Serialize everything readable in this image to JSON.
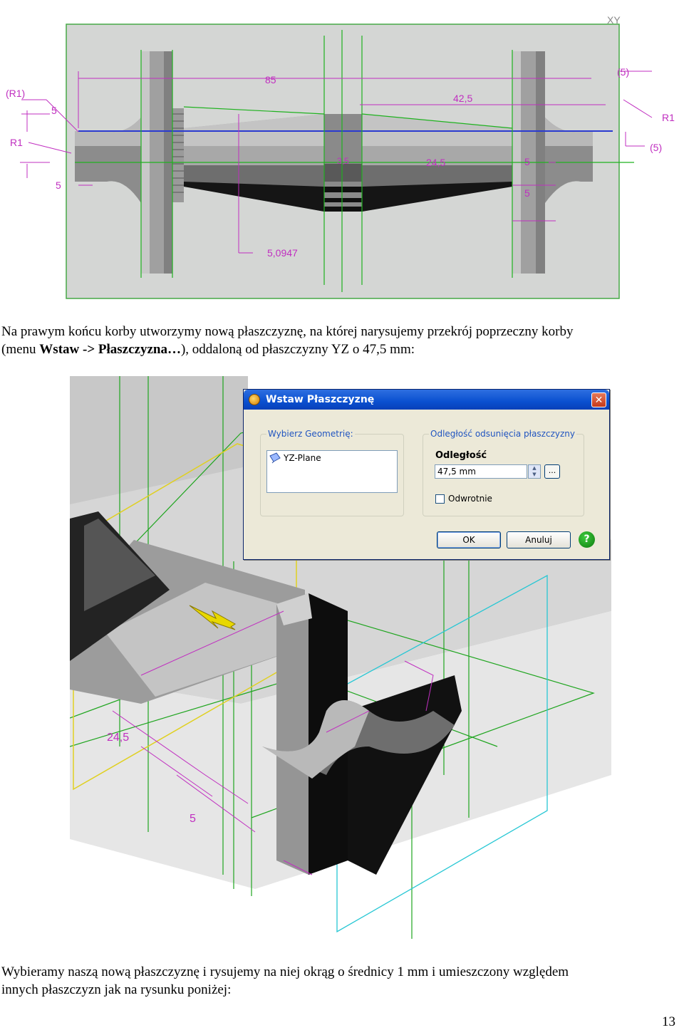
{
  "figure1": {
    "corner_label": "XY",
    "dimensions": {
      "r1_left_paren": "(R1)",
      "five_a": "5",
      "r1_left": "R1",
      "five_b": "5",
      "eighty_five": "85",
      "forty_two": "42,5",
      "five_paren_right": "(5)",
      "r1_right": "R1",
      "five_paren_right_b": "(5)",
      "twenty_four": "24,5",
      "five_c": "5",
      "five_d": "5",
      "depth": "5,0947",
      "thirty": "3,5"
    }
  },
  "paragraph1": {
    "line1": "Na prawym końcu korby utworzymy nową płaszczyznę, na której narysujemy przekrój poprzeczny korby",
    "line2_prefix": "(menu ",
    "line2_bold": "Wstaw -> Płaszczyzna…",
    "line2_suffix": "), oddaloną od płaszczyzny YZ o 47,5 mm:"
  },
  "figure2": {
    "labels": {
      "dim_a": "24,5",
      "dim_b": "5"
    }
  },
  "dialog": {
    "title": "Wstaw Płaszczyznę",
    "close_glyph": "✕",
    "group1_legend": "Wybierz Geometrię:",
    "list_item": "YZ-Plane",
    "group2_legend": "Odległość odsunięcia płaszczyzny",
    "distance_label": "Odległość",
    "distance_value": "47,5 mm",
    "spin_up": "▲",
    "spin_down": "▼",
    "browse": "...",
    "reverse_label": "Odwrotnie",
    "ok": "OK",
    "cancel": "Anuluj",
    "help": "?"
  },
  "paragraph2": {
    "line1": "Wybieramy naszą nową płaszczyznę i rysujemy na niej okrąg o średnicy 1 mm i umieszczony względem",
    "line2": "innych płaszczyzn jak na rysunku poniżej:"
  },
  "page_number": "13"
}
